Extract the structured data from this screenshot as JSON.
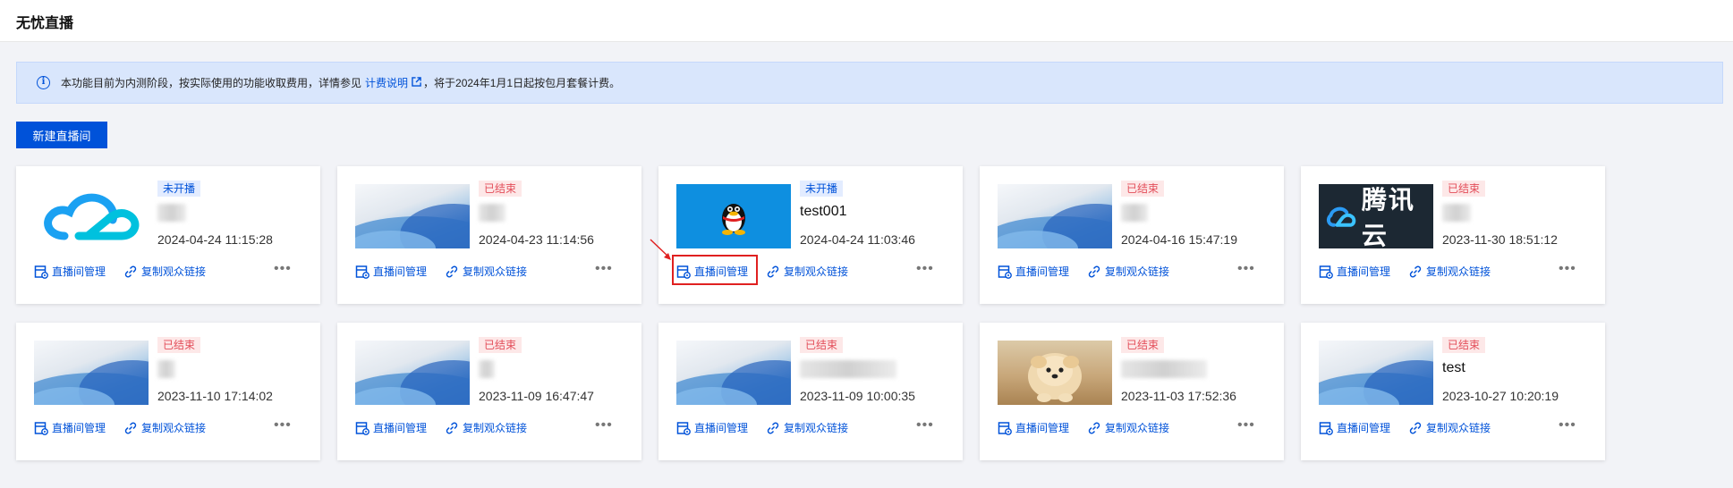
{
  "page": {
    "title": "无忧直播"
  },
  "notice": {
    "before": "本功能目前为内测阶段，按实际使用的功能收取费用，详情参见",
    "link": "计费说明",
    "after": "，将于2024年1月1日起按包月套餐计费。"
  },
  "toolbar": {
    "new_label": "新建直播间"
  },
  "card_actions": {
    "manage": "直播间管理",
    "copy": "复制观众链接",
    "more": "•••"
  },
  "rooms": [
    {
      "status": "未开播",
      "status_type": "pending",
      "name": "",
      "time": "2024-04-24 11:15:28",
      "thumb": "cloud-logo"
    },
    {
      "status": "已结束",
      "status_type": "ended",
      "name": "",
      "time": "2024-04-23 11:14:56",
      "thumb": "wave"
    },
    {
      "status": "未开播",
      "status_type": "pending",
      "name": "test001",
      "time": "2024-04-24 11:03:46",
      "thumb": "qq-penguin"
    },
    {
      "status": "已结束",
      "status_type": "ended",
      "name": "",
      "time": "2024-04-16 15:47:19",
      "thumb": "wave"
    },
    {
      "status": "已结束",
      "status_type": "ended",
      "name": "",
      "time": "2023-11-30 18:51:12",
      "thumb": "tencent-cloud-logo"
    },
    {
      "status": "已结束",
      "status_type": "ended",
      "name": "",
      "time": "2023-11-10 17:14:02",
      "thumb": "wave"
    },
    {
      "status": "已结束",
      "status_type": "ended",
      "name": "",
      "time": "2023-11-09 16:47:47",
      "thumb": "wave"
    },
    {
      "status": "已结束",
      "status_type": "ended",
      "name": "",
      "time": "2023-11-09 10:00:35",
      "thumb": "wave"
    },
    {
      "status": "已结束",
      "status_type": "ended",
      "name": "",
      "time": "2023-11-03 17:52:36",
      "thumb": "puppy-photo"
    },
    {
      "status": "已结束",
      "status_type": "ended",
      "name": "test",
      "time": "2023-10-27 10:20:19",
      "thumb": "wave"
    }
  ],
  "tencent_logo_text": "腾讯云",
  "colors": {
    "primary": "#0052d9",
    "ended": "#e34d59",
    "pending_bg": "#e3ecff",
    "highlight": "#e02020"
  }
}
